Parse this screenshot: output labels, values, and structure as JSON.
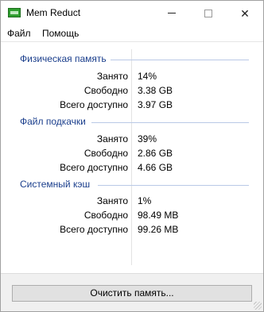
{
  "window": {
    "title": "Mem Reduct",
    "minimize_icon": "minimize-icon",
    "maximize_icon": "maximize-icon",
    "close_icon": "close-icon",
    "close_glyph": "✕"
  },
  "menu": {
    "items": [
      {
        "label": "Файл"
      },
      {
        "label": "Помощь"
      }
    ]
  },
  "groups": [
    {
      "title": "Физическая память",
      "rows": [
        {
          "label": "Занято",
          "value": "14%"
        },
        {
          "label": "Свободно",
          "value": "3.38 GB"
        },
        {
          "label": "Всего доступно",
          "value": "3.97 GB"
        }
      ]
    },
    {
      "title": "Файл подкачки",
      "rows": [
        {
          "label": "Занято",
          "value": "39%"
        },
        {
          "label": "Свободно",
          "value": "2.86 GB"
        },
        {
          "label": "Всего доступно",
          "value": "4.66 GB"
        }
      ]
    },
    {
      "title": "Системный кэш",
      "rows": [
        {
          "label": "Занято",
          "value": "1%"
        },
        {
          "label": "Свободно",
          "value": "98.49 MB"
        },
        {
          "label": "Всего доступно",
          "value": "99.26 MB"
        }
      ]
    }
  ],
  "footer": {
    "clean_button_label": "Очистить память..."
  },
  "colors": {
    "group_header": "#1a3e8c",
    "window_bg": "#ffffff",
    "footer_bg": "#f0f0f0"
  }
}
